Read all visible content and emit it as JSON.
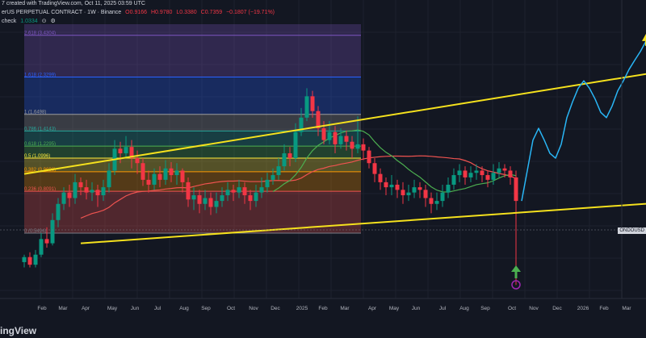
{
  "header": {
    "line1": "7 created with TradingView.com, Oct 11, 2025 03:59 UTC",
    "symbol": "erUS PERPETUAL CONTRACT · 1W · Binance",
    "ohlc": [
      "O0.9166",
      "H0.9780",
      "L0.3380",
      "C0.7359",
      "−0.1807 (−19.71%)"
    ],
    "indicator_name": "check",
    "indicator_value": "1.0334"
  },
  "price_tag": "ONDOUSD",
  "brand": "ingView",
  "colors": {
    "background": "#131722",
    "up_candle": "#089981",
    "down_candle": "#f23645",
    "trendline": "#f5e11d",
    "projection": "#29b6f6",
    "arrow_up": "#f5e11d",
    "arrow_green": "#4caf50",
    "ma_green": "#4caf50",
    "ma_red": "#ef5350"
  },
  "chart_data": {
    "type": "candlestick",
    "x_tick_labels": [
      "Feb",
      "Mar",
      "Apr",
      "May",
      "Jun",
      "Jul",
      "Aug",
      "Sep",
      "Oct",
      "Nov",
      "Dec",
      "2025",
      "Feb",
      "Mar",
      "Apr",
      "May",
      "Jun",
      "Jul",
      "Aug",
      "Sep",
      "Oct",
      "Nov",
      "Dec",
      "2026",
      "Feb",
      "Mar"
    ],
    "ylim": [
      0.3,
      3.8
    ],
    "fib_levels": [
      {
        "label": "2.618 (3.4304)",
        "value": 3.4304,
        "color": "#7e57c2"
      },
      {
        "label": "1.618 (2.3299)",
        "value": 2.3299,
        "color": "#2962ff"
      },
      {
        "label": "1 (1.6498)",
        "value": 1.6498,
        "color": "#9e9e9e"
      },
      {
        "label": "0.786 (1.4143)",
        "value": 1.4143,
        "color": "#26a69a"
      },
      {
        "label": "0.618 (1.2295)",
        "value": 1.2295,
        "color": "#4caf50"
      },
      {
        "label": "0.5 (1.0996)",
        "value": 1.0996,
        "color": "#ffeb3b"
      },
      {
        "label": "0.382 (0.9698)",
        "value": 0.9698,
        "color": "#ff9800"
      },
      {
        "label": "0.236 (0.8091)",
        "value": 0.8091,
        "color": "#ef5350"
      },
      {
        "label": "0 (0.5494)",
        "value": 0.5494,
        "color": "#787b86"
      }
    ],
    "candles": [
      [
        0.42,
        0.44,
        0.4,
        0.45
      ],
      [
        0.44,
        0.41,
        0.4,
        0.46
      ],
      [
        0.41,
        0.45,
        0.4,
        0.47
      ],
      [
        0.45,
        0.52,
        0.44,
        0.55
      ],
      [
        0.52,
        0.5,
        0.48,
        0.58
      ],
      [
        0.5,
        0.62,
        0.49,
        0.66
      ],
      [
        0.62,
        0.72,
        0.58,
        0.76
      ],
      [
        0.72,
        0.8,
        0.68,
        0.84
      ],
      [
        0.8,
        0.76,
        0.7,
        0.86
      ],
      [
        0.76,
        0.88,
        0.72,
        0.95
      ],
      [
        0.88,
        0.84,
        0.78,
        0.92
      ],
      [
        0.84,
        0.8,
        0.75,
        0.9
      ],
      [
        0.8,
        0.82,
        0.74,
        0.88
      ],
      [
        0.82,
        0.78,
        0.7,
        0.86
      ],
      [
        0.78,
        0.84,
        0.74,
        0.9
      ],
      [
        0.84,
        0.98,
        0.8,
        1.05
      ],
      [
        0.98,
        1.2,
        0.94,
        1.3
      ],
      [
        1.2,
        1.15,
        1.05,
        1.28
      ],
      [
        1.15,
        1.22,
        1.1,
        1.35
      ],
      [
        1.22,
        1.1,
        1.0,
        1.3
      ],
      [
        1.1,
        1.05,
        0.95,
        1.18
      ],
      [
        1.05,
        0.9,
        0.85,
        1.1
      ],
      [
        0.9,
        0.86,
        0.8,
        0.98
      ],
      [
        0.86,
        0.95,
        0.82,
        1.0
      ],
      [
        0.95,
        0.9,
        0.84,
        1.02
      ],
      [
        0.9,
        1.0,
        0.86,
        1.08
      ],
      [
        1.0,
        0.94,
        0.88,
        1.06
      ],
      [
        0.94,
        0.98,
        0.86,
        1.05
      ],
      [
        0.98,
        0.88,
        0.8,
        1.0
      ],
      [
        0.88,
        0.75,
        0.7,
        0.92
      ],
      [
        0.75,
        0.78,
        0.68,
        0.84
      ],
      [
        0.78,
        0.72,
        0.66,
        0.82
      ],
      [
        0.72,
        0.76,
        0.68,
        0.82
      ],
      [
        0.76,
        0.7,
        0.65,
        0.8
      ],
      [
        0.7,
        0.74,
        0.66,
        0.8
      ],
      [
        0.74,
        0.78,
        0.7,
        0.84
      ],
      [
        0.78,
        0.82,
        0.74,
        0.88
      ],
      [
        0.82,
        0.8,
        0.74,
        0.86
      ],
      [
        0.8,
        0.84,
        0.76,
        0.9
      ],
      [
        0.84,
        0.78,
        0.72,
        0.88
      ],
      [
        0.78,
        0.74,
        0.68,
        0.82
      ],
      [
        0.74,
        0.8,
        0.7,
        0.86
      ],
      [
        0.8,
        0.84,
        0.76,
        0.92
      ],
      [
        0.84,
        0.9,
        0.8,
        0.96
      ],
      [
        0.9,
        0.94,
        0.86,
        1.0
      ],
      [
        0.94,
        1.02,
        0.9,
        1.1
      ],
      [
        1.02,
        1.15,
        0.98,
        1.25
      ],
      [
        1.15,
        1.1,
        1.02,
        1.22
      ],
      [
        1.1,
        1.4,
        1.06,
        1.52
      ],
      [
        1.4,
        1.6,
        1.35,
        1.75
      ],
      [
        1.6,
        1.95,
        1.55,
        2.1
      ],
      [
        1.95,
        1.7,
        1.6,
        2.05
      ],
      [
        1.7,
        1.45,
        1.35,
        1.78
      ],
      [
        1.45,
        1.3,
        1.25,
        1.55
      ],
      [
        1.3,
        1.4,
        1.25,
        1.55
      ],
      [
        1.4,
        1.25,
        1.15,
        1.48
      ],
      [
        1.25,
        1.35,
        1.2,
        1.45
      ],
      [
        1.35,
        1.28,
        1.18,
        1.42
      ],
      [
        1.28,
        1.2,
        1.1,
        1.35
      ],
      [
        1.2,
        1.25,
        1.15,
        1.62
      ],
      [
        1.25,
        1.18,
        1.08,
        1.32
      ],
      [
        1.18,
        1.05,
        1.0,
        1.22
      ],
      [
        1.05,
        0.95,
        0.88,
        1.1
      ],
      [
        0.95,
        0.88,
        0.82,
        1.0
      ],
      [
        0.88,
        0.84,
        0.78,
        0.92
      ],
      [
        0.84,
        0.86,
        0.78,
        0.94
      ],
      [
        0.86,
        0.82,
        0.76,
        0.9
      ],
      [
        0.82,
        0.78,
        0.72,
        0.88
      ],
      [
        0.78,
        0.8,
        0.74,
        0.86
      ],
      [
        0.8,
        0.84,
        0.76,
        0.9
      ],
      [
        0.84,
        0.82,
        0.76,
        0.88
      ],
      [
        0.82,
        0.76,
        0.7,
        0.86
      ],
      [
        0.76,
        0.72,
        0.66,
        0.8
      ],
      [
        0.72,
        0.74,
        0.68,
        0.8
      ],
      [
        0.74,
        0.8,
        0.7,
        0.86
      ],
      [
        0.8,
        0.86,
        0.76,
        0.92
      ],
      [
        0.86,
        0.94,
        0.82,
        1.0
      ],
      [
        0.94,
        0.98,
        0.88,
        1.04
      ],
      [
        0.98,
        0.92,
        0.86,
        1.02
      ],
      [
        0.92,
        0.96,
        0.88,
        1.02
      ],
      [
        0.96,
        0.98,
        0.9,
        1.04
      ],
      [
        0.98,
        0.94,
        0.88,
        1.02
      ],
      [
        0.94,
        0.9,
        0.84,
        0.98
      ],
      [
        0.9,
        0.96,
        0.86,
        1.04
      ],
      [
        0.96,
        1.0,
        0.92,
        1.06
      ],
      [
        1.0,
        0.98,
        0.92,
        1.04
      ],
      [
        0.98,
        0.92,
        0.86,
        1.02
      ],
      [
        0.92,
        0.74,
        0.34,
        0.98
      ]
    ],
    "trendlines": [
      {
        "name": "upper",
        "from": [
          0,
          0.95
        ],
        "to": [
          155,
          3.5
        ]
      },
      {
        "name": "lower",
        "from": [
          10,
          0.5
        ],
        "to": [
          155,
          0.85
        ]
      },
      {
        "name": "support",
        "from": [
          126,
          0.35
        ],
        "to": [
          158,
          0.36
        ]
      }
    ],
    "projection": [
      [
        88,
        0.74
      ],
      [
        89,
        0.98
      ],
      [
        90,
        1.3
      ],
      [
        91,
        1.45
      ],
      [
        92,
        1.3
      ],
      [
        93,
        1.15
      ],
      [
        94,
        1.1
      ],
      [
        95,
        1.25
      ],
      [
        96,
        1.6
      ],
      [
        97,
        1.85
      ],
      [
        98,
        2.1
      ],
      [
        99,
        2.25
      ],
      [
        100,
        2.1
      ],
      [
        101,
        1.9
      ],
      [
        102,
        1.68
      ],
      [
        103,
        1.6
      ],
      [
        104,
        1.78
      ],
      [
        105,
        2.05
      ],
      [
        106,
        2.25
      ],
      [
        107,
        2.5
      ],
      [
        108,
        2.72
      ],
      [
        109,
        2.95
      ],
      [
        110,
        3.25
      ]
    ]
  }
}
